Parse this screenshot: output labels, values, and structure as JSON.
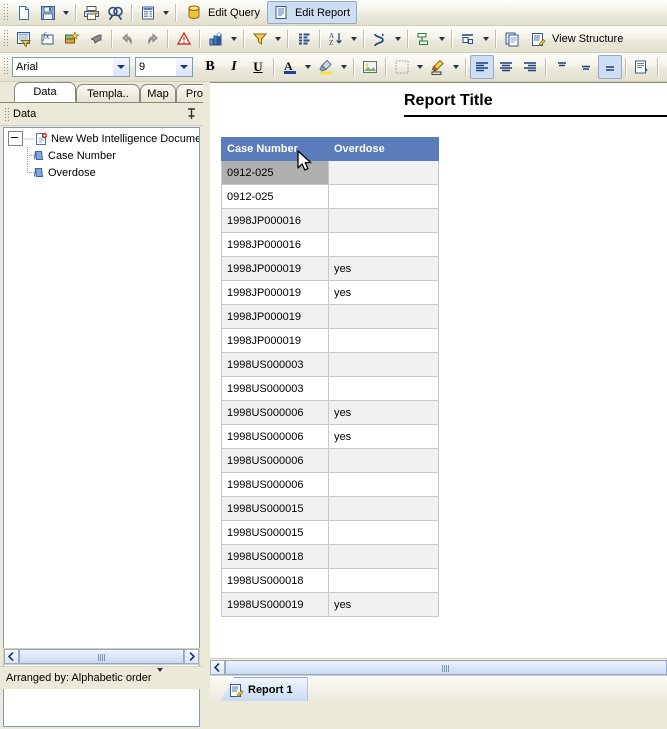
{
  "toolbars": {
    "main": {
      "items": [
        {
          "name": "new-document-icon",
          "label": "New"
        },
        {
          "name": "save-icon",
          "label": "Save"
        },
        {
          "name": "save-dropdown-caret",
          "label": ""
        },
        {
          "name": "print-icon",
          "label": "Print"
        },
        {
          "name": "find-icon",
          "label": "Find"
        },
        {
          "name": "page-setup-icon",
          "label": "Page Setup"
        },
        {
          "name": "page-setup-dropdown-caret",
          "label": ""
        }
      ],
      "edit_query_label": "Edit Query",
      "edit_report_label": "Edit Report"
    },
    "report": {
      "items": [
        {
          "name": "edit-data-provider-icon"
        },
        {
          "name": "formula-editor-icon"
        },
        {
          "name": "insert-variable-icon"
        },
        {
          "name": "undo-all-icon"
        },
        {
          "name": "undo-icon"
        },
        {
          "name": "redo-icon"
        },
        {
          "name": "alerters-icon"
        },
        {
          "name": "insert-chart-icon"
        },
        {
          "name": "filter-icon"
        },
        {
          "name": "ranking-icon"
        },
        {
          "name": "sort-icon"
        },
        {
          "name": "break-icon"
        },
        {
          "name": "insert-row-icon"
        },
        {
          "name": "merge-cells-icon"
        },
        {
          "name": "align-table-icon"
        },
        {
          "name": "duplicate-report-icon"
        }
      ],
      "view_structure_label": "View Structure"
    },
    "format": {
      "font_name": "Arial",
      "font_size": "9",
      "bold_label": "B",
      "italic_label": "I",
      "underline_label": "U",
      "items": [
        {
          "name": "font-color-icon"
        },
        {
          "name": "highlight-color-icon"
        },
        {
          "name": "background-image-icon"
        },
        {
          "name": "borders-icon"
        },
        {
          "name": "border-style-icon"
        },
        {
          "name": "align-left-icon"
        },
        {
          "name": "align-center-icon"
        },
        {
          "name": "align-right-icon"
        },
        {
          "name": "align-top-icon"
        },
        {
          "name": "align-middle-icon"
        },
        {
          "name": "align-bottom-icon"
        },
        {
          "name": "wrap-text-icon"
        },
        {
          "name": "autofit-icon"
        },
        {
          "name": "format-painter-icon"
        }
      ]
    }
  },
  "left_panel": {
    "tabs": [
      {
        "label": "Data",
        "selected": true
      },
      {
        "label": "Templa..",
        "selected": false
      },
      {
        "label": "Map",
        "selected": false
      },
      {
        "label": "Propert..",
        "selected": false
      }
    ],
    "header_title": "Data",
    "pin_icon": "pin-icon",
    "tree": {
      "root": "New Web Intelligence Document",
      "children": [
        {
          "label": "Case Number"
        },
        {
          "label": "Overdose"
        }
      ]
    },
    "arranged_by_label": "Arranged by: Alphabetic order"
  },
  "report": {
    "title": "Report Title",
    "tab_label": "Report 1",
    "table": {
      "columns": [
        "Case Number",
        "Overdose"
      ],
      "rows": [
        {
          "case": "0912-025",
          "overdose": "",
          "shade": "gray",
          "selected": true
        },
        {
          "case": "0912-025",
          "overdose": "",
          "shade": "white",
          "selected": false
        },
        {
          "case": "1998JP000016",
          "overdose": "",
          "shade": "gray",
          "selected": false
        },
        {
          "case": "1998JP000016",
          "overdose": "",
          "shade": "white",
          "selected": false
        },
        {
          "case": "1998JP000019",
          "overdose": "yes",
          "shade": "gray",
          "selected": false
        },
        {
          "case": "1998JP000019",
          "overdose": "yes",
          "shade": "white",
          "selected": false
        },
        {
          "case": "1998JP000019",
          "overdose": "",
          "shade": "gray",
          "selected": false
        },
        {
          "case": "1998JP000019",
          "overdose": "",
          "shade": "white",
          "selected": false
        },
        {
          "case": "1998US000003",
          "overdose": "",
          "shade": "gray",
          "selected": false
        },
        {
          "case": "1998US000003",
          "overdose": "",
          "shade": "white",
          "selected": false
        },
        {
          "case": "1998US000006",
          "overdose": "yes",
          "shade": "gray",
          "selected": false
        },
        {
          "case": "1998US000006",
          "overdose": "yes",
          "shade": "white",
          "selected": false
        },
        {
          "case": "1998US000006",
          "overdose": "",
          "shade": "gray",
          "selected": false
        },
        {
          "case": "1998US000006",
          "overdose": "",
          "shade": "white",
          "selected": false
        },
        {
          "case": "1998US000015",
          "overdose": "",
          "shade": "gray",
          "selected": false
        },
        {
          "case": "1998US000015",
          "overdose": "",
          "shade": "white",
          "selected": false
        },
        {
          "case": "1998US000018",
          "overdose": "",
          "shade": "gray",
          "selected": false
        },
        {
          "case": "1998US000018",
          "overdose": "",
          "shade": "white",
          "selected": false
        },
        {
          "case": "1998US000019",
          "overdose": "yes",
          "shade": "gray",
          "selected": false
        }
      ]
    }
  },
  "colors": {
    "header_blue": "#5a7cbb",
    "row_gray": "#f1f1f1",
    "row_selected": "#b0b0b0",
    "toolbar_bg": "#ece9d8"
  }
}
